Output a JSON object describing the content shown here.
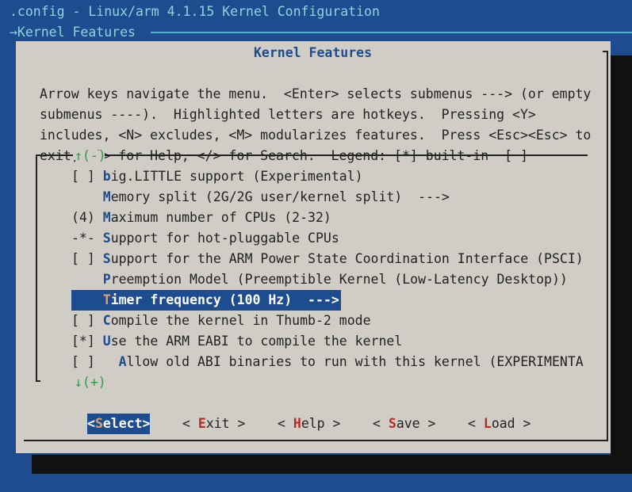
{
  "window": {
    "title": ".config - Linux/arm 4.1.15 Kernel Configuration",
    "breadcrumb": "→Kernel Features"
  },
  "dialog": {
    "title": "Kernel Features",
    "help_lines": [
      "Arrow keys navigate the menu.  <Enter> selects submenus ---> (or empty",
      "submenus ----).  Highlighted letters are hotkeys.  Pressing <Y>",
      "includes, <N> excludes, <M> modularizes features.  Press <Esc><Esc> to",
      "exit, <?> for Help, </> for Search.  Legend: [*] built-in  [ ]"
    ],
    "scroll_up": "↑(-)",
    "scroll_down": "↓(+)"
  },
  "menu": {
    "items": [
      {
        "prefix": "[ ] ",
        "hotkey": "b",
        "rest": "ig.LITTLE support (Experimental)"
      },
      {
        "prefix": "    ",
        "hotkey": "M",
        "rest": "emory split (2G/2G user/kernel split)  --->"
      },
      {
        "prefix": "(4) ",
        "hotkey": "M",
        "rest": "aximum number of CPUs (2-32)"
      },
      {
        "prefix": "-*- ",
        "hotkey": "S",
        "rest": "upport for hot-pluggable CPUs"
      },
      {
        "prefix": "[ ] ",
        "hotkey": "S",
        "rest": "upport for the ARM Power State Coordination Interface (PSCI)"
      },
      {
        "prefix": "    ",
        "hotkey": "P",
        "rest": "reemption Model (Preemptible Kernel (Low-Latency Desktop))"
      },
      {
        "prefix": "    ",
        "hotkey": "T",
        "rest": "imer frequency (100 Hz)  --->"
      },
      {
        "prefix": "[ ] ",
        "hotkey": "C",
        "rest": "ompile the kernel in Thumb-2 mode"
      },
      {
        "prefix": "[*] ",
        "hotkey": "U",
        "rest": "se the ARM EABI to compile the kernel"
      },
      {
        "prefix": "[ ]   ",
        "hotkey": "A",
        "rest": "llow old ABI binaries to run with this kernel (EXPERIMENTA"
      }
    ],
    "selected_index": 6
  },
  "buttons": [
    {
      "pre": "<",
      "hotkey": "S",
      "post": "elect>"
    },
    {
      "pre": "< ",
      "hotkey": "E",
      "post": "xit >"
    },
    {
      "pre": "< ",
      "hotkey": "H",
      "post": "elp >"
    },
    {
      "pre": "< ",
      "hotkey": "S",
      "post": "ave >"
    },
    {
      "pre": "< ",
      "hotkey": "L",
      "post": "oad >"
    }
  ],
  "colors": {
    "background": "#1d4d8f",
    "dialog": "#d0cdc7",
    "accent": "#1d4d8f",
    "hotkey_button": "#b52a26",
    "scroll_arrow": "#2f9a4e"
  }
}
